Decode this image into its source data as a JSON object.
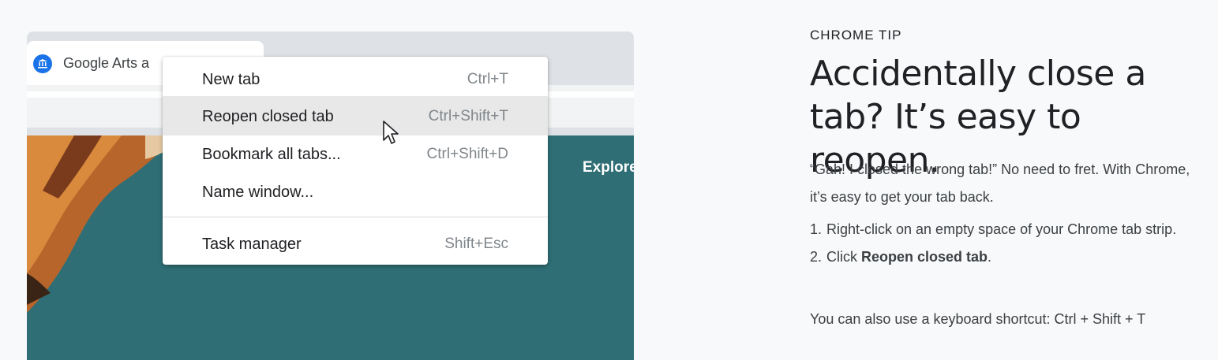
{
  "browser": {
    "tab_title": "Google Arts a",
    "tab_icon": "museum-icon",
    "content_link": "Explore",
    "colors": {
      "tabstrip": "#dee1e6",
      "content": "#2f6e75"
    }
  },
  "context_menu": {
    "items": [
      {
        "label": "New tab",
        "shortcut": "Ctrl+T"
      },
      {
        "label": "Reopen closed tab",
        "shortcut": "Ctrl+Shift+T",
        "highlighted": true
      },
      {
        "label": "Bookmark all tabs...",
        "shortcut": "Ctrl+Shift+D"
      },
      {
        "label": "Name window...",
        "shortcut": ""
      },
      {
        "label": "Task manager",
        "shortcut": "Shift+Esc"
      }
    ]
  },
  "tip": {
    "kicker": "CHROME TIP",
    "title": "Accidentally close a tab? It’s easy to reopen.",
    "intro": "“Gah! I closed the wrong tab!” No need to fret. With Chrome, it’s easy to get your tab back.",
    "steps": [
      {
        "num": "1.",
        "text": "Right-click on an empty space of your Chrome tab strip."
      },
      {
        "num": "2.",
        "text_before": "Click ",
        "bold": "Reopen closed tab",
        "text_after": "."
      }
    ],
    "note": "You can also use a keyboard shortcut: Ctrl + Shift + T"
  }
}
